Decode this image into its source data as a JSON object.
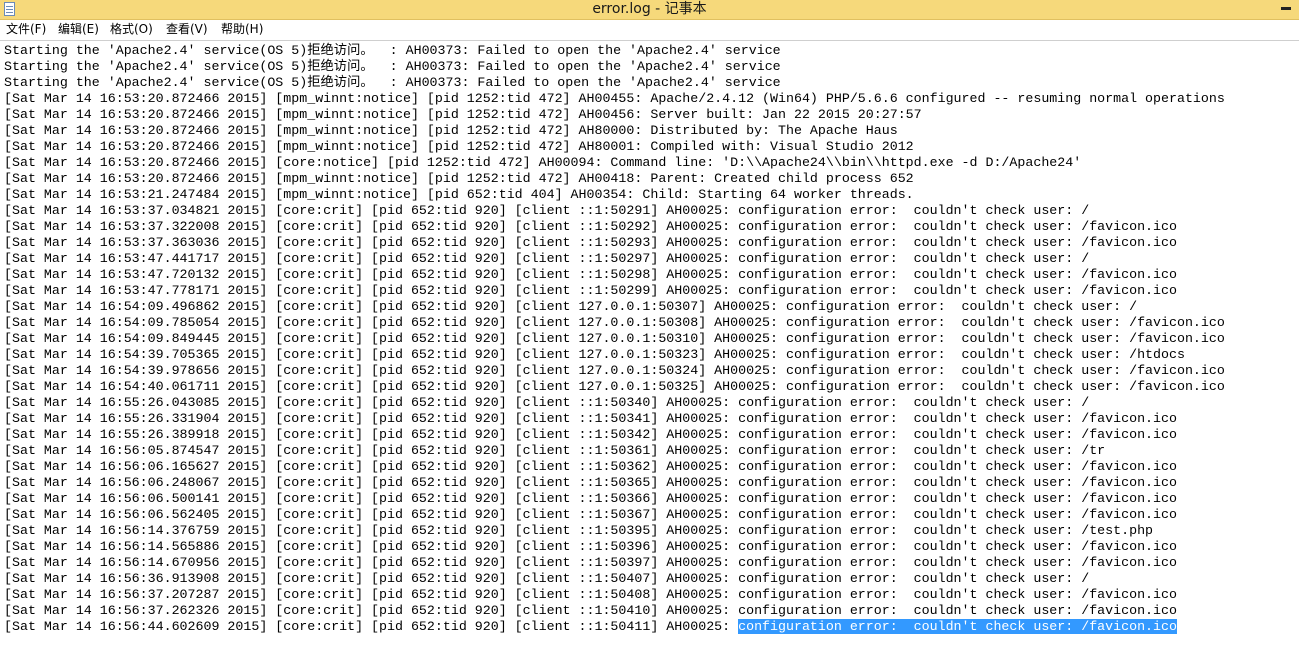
{
  "window": {
    "title": "error.log - 记事本",
    "icon": "notepad-icon",
    "accent": "#f6d97b"
  },
  "menu": {
    "file": "文件(F)",
    "edit": "编辑(E)",
    "format": "格式(O)",
    "view": "查看(V)",
    "help": "帮助(H)"
  },
  "selection": {
    "color": "#3399ff",
    "text": "configuration error:  couldn't check user: /favicon.ico"
  },
  "log_lines": [
    "Starting the 'Apache2.4' service(OS 5)拒绝访问。  : AH00373: Failed to open the 'Apache2.4' service",
    "Starting the 'Apache2.4' service(OS 5)拒绝访问。  : AH00373: Failed to open the 'Apache2.4' service",
    "Starting the 'Apache2.4' service(OS 5)拒绝访问。  : AH00373: Failed to open the 'Apache2.4' service",
    "[Sat Mar 14 16:53:20.872466 2015] [mpm_winnt:notice] [pid 1252:tid 472] AH00455: Apache/2.4.12 (Win64) PHP/5.6.6 configured -- resuming normal operations",
    "[Sat Mar 14 16:53:20.872466 2015] [mpm_winnt:notice] [pid 1252:tid 472] AH00456: Server built: Jan 22 2015 20:27:57",
    "[Sat Mar 14 16:53:20.872466 2015] [mpm_winnt:notice] [pid 1252:tid 472] AH80000: Distributed by: The Apache Haus",
    "[Sat Mar 14 16:53:20.872466 2015] [mpm_winnt:notice] [pid 1252:tid 472] AH80001: Compiled with: Visual Studio 2012",
    "[Sat Mar 14 16:53:20.872466 2015] [core:notice] [pid 1252:tid 472] AH00094: Command line: 'D:\\\\Apache24\\\\bin\\\\httpd.exe -d D:/Apache24'",
    "[Sat Mar 14 16:53:20.872466 2015] [mpm_winnt:notice] [pid 1252:tid 472] AH00418: Parent: Created child process 652",
    "[Sat Mar 14 16:53:21.247484 2015] [mpm_winnt:notice] [pid 652:tid 404] AH00354: Child: Starting 64 worker threads.",
    "[Sat Mar 14 16:53:37.034821 2015] [core:crit] [pid 652:tid 920] [client ::1:50291] AH00025: configuration error:  couldn't check user: /",
    "[Sat Mar 14 16:53:37.322008 2015] [core:crit] [pid 652:tid 920] [client ::1:50292] AH00025: configuration error:  couldn't check user: /favicon.ico",
    "[Sat Mar 14 16:53:37.363036 2015] [core:crit] [pid 652:tid 920] [client ::1:50293] AH00025: configuration error:  couldn't check user: /favicon.ico",
    "[Sat Mar 14 16:53:47.441717 2015] [core:crit] [pid 652:tid 920] [client ::1:50297] AH00025: configuration error:  couldn't check user: /",
    "[Sat Mar 14 16:53:47.720132 2015] [core:crit] [pid 652:tid 920] [client ::1:50298] AH00025: configuration error:  couldn't check user: /favicon.ico",
    "[Sat Mar 14 16:53:47.778171 2015] [core:crit] [pid 652:tid 920] [client ::1:50299] AH00025: configuration error:  couldn't check user: /favicon.ico",
    "[Sat Mar 14 16:54:09.496862 2015] [core:crit] [pid 652:tid 920] [client 127.0.0.1:50307] AH00025: configuration error:  couldn't check user: /",
    "[Sat Mar 14 16:54:09.785054 2015] [core:crit] [pid 652:tid 920] [client 127.0.0.1:50308] AH00025: configuration error:  couldn't check user: /favicon.ico",
    "[Sat Mar 14 16:54:09.849445 2015] [core:crit] [pid 652:tid 920] [client 127.0.0.1:50310] AH00025: configuration error:  couldn't check user: /favicon.ico",
    "[Sat Mar 14 16:54:39.705365 2015] [core:crit] [pid 652:tid 920] [client 127.0.0.1:50323] AH00025: configuration error:  couldn't check user: /htdocs",
    "[Sat Mar 14 16:54:39.978656 2015] [core:crit] [pid 652:tid 920] [client 127.0.0.1:50324] AH00025: configuration error:  couldn't check user: /favicon.ico",
    "[Sat Mar 14 16:54:40.061711 2015] [core:crit] [pid 652:tid 920] [client 127.0.0.1:50325] AH00025: configuration error:  couldn't check user: /favicon.ico",
    "[Sat Mar 14 16:55:26.043085 2015] [core:crit] [pid 652:tid 920] [client ::1:50340] AH00025: configuration error:  couldn't check user: /",
    "[Sat Mar 14 16:55:26.331904 2015] [core:crit] [pid 652:tid 920] [client ::1:50341] AH00025: configuration error:  couldn't check user: /favicon.ico",
    "[Sat Mar 14 16:55:26.389918 2015] [core:crit] [pid 652:tid 920] [client ::1:50342] AH00025: configuration error:  couldn't check user: /favicon.ico",
    "[Sat Mar 14 16:56:05.874547 2015] [core:crit] [pid 652:tid 920] [client ::1:50361] AH00025: configuration error:  couldn't check user: /tr",
    "[Sat Mar 14 16:56:06.165627 2015] [core:crit] [pid 652:tid 920] [client ::1:50362] AH00025: configuration error:  couldn't check user: /favicon.ico",
    "[Sat Mar 14 16:56:06.248067 2015] [core:crit] [pid 652:tid 920] [client ::1:50365] AH00025: configuration error:  couldn't check user: /favicon.ico",
    "[Sat Mar 14 16:56:06.500141 2015] [core:crit] [pid 652:tid 920] [client ::1:50366] AH00025: configuration error:  couldn't check user: /favicon.ico",
    "[Sat Mar 14 16:56:06.562405 2015] [core:crit] [pid 652:tid 920] [client ::1:50367] AH00025: configuration error:  couldn't check user: /favicon.ico",
    "[Sat Mar 14 16:56:14.376759 2015] [core:crit] [pid 652:tid 920] [client ::1:50395] AH00025: configuration error:  couldn't check user: /test.php",
    "[Sat Mar 14 16:56:14.565886 2015] [core:crit] [pid 652:tid 920] [client ::1:50396] AH00025: configuration error:  couldn't check user: /favicon.ico",
    "[Sat Mar 14 16:56:14.670956 2015] [core:crit] [pid 652:tid 920] [client ::1:50397] AH00025: configuration error:  couldn't check user: /favicon.ico",
    "[Sat Mar 14 16:56:36.913908 2015] [core:crit] [pid 652:tid 920] [client ::1:50407] AH00025: configuration error:  couldn't check user: /",
    "[Sat Mar 14 16:56:37.207287 2015] [core:crit] [pid 652:tid 920] [client ::1:50408] AH00025: configuration error:  couldn't check user: /favicon.ico",
    "[Sat Mar 14 16:56:37.262326 2015] [core:crit] [pid 652:tid 920] [client ::1:50410] AH00025: configuration error:  couldn't check user: /favicon.ico",
    "[Sat Mar 14 16:56:44.602609 2015] [core:crit] [pid 652:tid 920] [client ::1:50411] AH00025: "
  ]
}
